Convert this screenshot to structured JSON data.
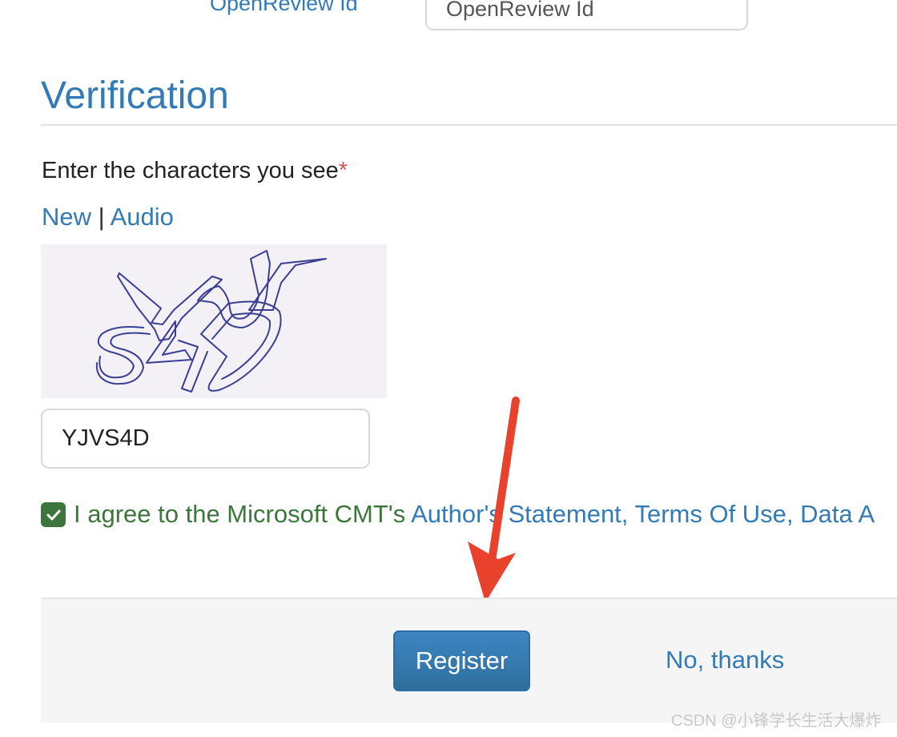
{
  "account": {
    "openreview_label": "OpenReview Id",
    "openreview_placeholder": "OpenReview Id"
  },
  "verification": {
    "title": "Verification",
    "prompt": "Enter the characters you see",
    "required_marker": "*",
    "new_link": "New",
    "separator": "|",
    "audio_link": "Audio",
    "captcha_image_text": "YJVS4D",
    "captcha_value": "YJVS4D"
  },
  "agreement": {
    "checked": true,
    "text_prefix": "I agree to the Microsoft CMT's ",
    "text_link": "Author's Statement, Terms Of Use, Data A"
  },
  "footer": {
    "register_label": "Register",
    "no_thanks_label": "No, thanks"
  },
  "watermark": "CSDN @小锋学长生活大爆炸",
  "colors": {
    "link": "#337ab7",
    "success": "#3c763d",
    "required": "#d9534f",
    "annotation_arrow": "#e8412c"
  },
  "icons": {
    "checkbox": "check-icon",
    "annotation": "red-arrow-icon"
  }
}
